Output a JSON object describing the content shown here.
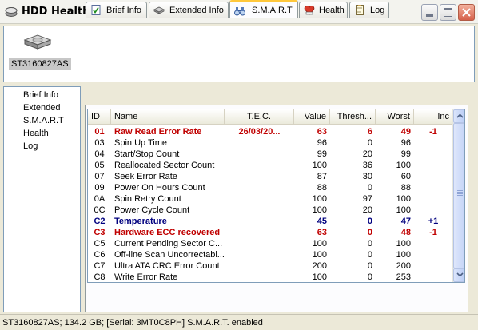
{
  "window": {
    "title": "HDD Health"
  },
  "device": {
    "label": "ST3160827AS"
  },
  "nav": {
    "items": [
      "Brief Info",
      "Extended",
      "S.M.A.R.T",
      "Health",
      "Log"
    ]
  },
  "tabs": [
    {
      "label": "Brief Info",
      "icon": "document-check-icon"
    },
    {
      "label": "Extended Info",
      "icon": "drive-icon"
    },
    {
      "label": "S.M.A.R.T",
      "icon": "binoculars-icon",
      "active": true
    },
    {
      "label": "Health",
      "icon": "heart-monitor-icon"
    },
    {
      "label": "Log",
      "icon": "notepad-icon"
    }
  ],
  "table": {
    "headers": [
      "ID",
      "Name",
      "T.E.C.",
      "Value",
      "Thresh...",
      "Worst",
      "Inc"
    ],
    "rows": [
      {
        "id": "01",
        "name": "Raw Read Error Rate",
        "tec": "26/03/20...",
        "value": "63",
        "thresh": "6",
        "worst": "49",
        "inc": "-1",
        "style": "warn"
      },
      {
        "id": "03",
        "name": "Spin Up Time",
        "tec": "",
        "value": "96",
        "thresh": "0",
        "worst": "96",
        "inc": "",
        "style": ""
      },
      {
        "id": "04",
        "name": "Start/Stop Count",
        "tec": "",
        "value": "99",
        "thresh": "20",
        "worst": "99",
        "inc": "",
        "style": ""
      },
      {
        "id": "05",
        "name": "Reallocated Sector Count",
        "tec": "",
        "value": "100",
        "thresh": "36",
        "worst": "100",
        "inc": "",
        "style": ""
      },
      {
        "id": "07",
        "name": "Seek Error Rate",
        "tec": "",
        "value": "87",
        "thresh": "30",
        "worst": "60",
        "inc": "",
        "style": ""
      },
      {
        "id": "09",
        "name": "Power On Hours Count",
        "tec": "",
        "value": "88",
        "thresh": "0",
        "worst": "88",
        "inc": "",
        "style": ""
      },
      {
        "id": "0A",
        "name": "Spin Retry Count",
        "tec": "",
        "value": "100",
        "thresh": "97",
        "worst": "100",
        "inc": "",
        "style": ""
      },
      {
        "id": "0C",
        "name": "Power Cycle Count",
        "tec": "",
        "value": "100",
        "thresh": "20",
        "worst": "100",
        "inc": "",
        "style": ""
      },
      {
        "id": "C2",
        "name": "Temperature",
        "tec": "",
        "value": "45",
        "thresh": "0",
        "worst": "47",
        "inc": "+1",
        "style": "temp"
      },
      {
        "id": "C3",
        "name": "Hardware ECC recovered",
        "tec": "",
        "value": "63",
        "thresh": "0",
        "worst": "48",
        "inc": "-1",
        "style": "warn"
      },
      {
        "id": "C5",
        "name": "Current Pending Sector C...",
        "tec": "",
        "value": "100",
        "thresh": "0",
        "worst": "100",
        "inc": "",
        "style": ""
      },
      {
        "id": "C6",
        "name": "Off-line Scan Uncorrectabl...",
        "tec": "",
        "value": "100",
        "thresh": "0",
        "worst": "100",
        "inc": "",
        "style": ""
      },
      {
        "id": "C7",
        "name": "Ultra ATA CRC Error Count",
        "tec": "",
        "value": "200",
        "thresh": "0",
        "worst": "200",
        "inc": "",
        "style": ""
      },
      {
        "id": "C8",
        "name": "Write Error Rate",
        "tec": "",
        "value": "100",
        "thresh": "0",
        "worst": "253",
        "inc": "",
        "style": ""
      }
    ]
  },
  "status": {
    "text": "ST3160827AS;  134.2 GB;  [Serial: 3MT0C8PH]   S.M.A.R.T. enabled"
  },
  "colors": {
    "warning": "#c00000",
    "temperature": "#00007f",
    "active_tab_accent": "#ffc83c"
  }
}
